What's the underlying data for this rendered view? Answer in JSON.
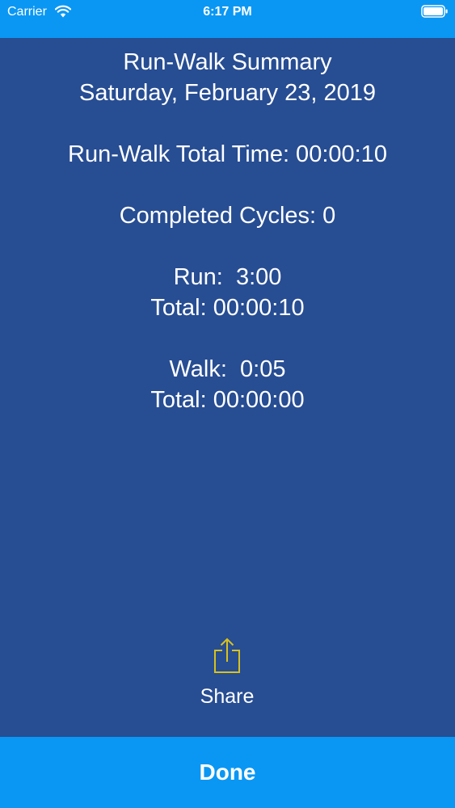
{
  "status_bar": {
    "carrier": "Carrier",
    "time": "6:17 PM",
    "wifi_icon": "wifi-icon",
    "battery_icon": "battery-icon"
  },
  "summary": {
    "title": "Run-Walk Summary",
    "date": "Saturday, February 23, 2019",
    "total_time": "Run-Walk Total Time: 00:00:10",
    "completed_cycles": "Completed Cycles: 0",
    "run_interval": "Run:  3:00",
    "run_total": "Total: 00:00:10",
    "walk_interval": "Walk:  0:05",
    "walk_total": "Total: 00:00:00"
  },
  "share": {
    "label": "Share",
    "icon": "share-icon",
    "icon_color": "#d8c21d"
  },
  "done": {
    "label": "Done"
  },
  "colors": {
    "background": "#274d93",
    "accent": "#0a97f4",
    "text": "#ffffff"
  }
}
